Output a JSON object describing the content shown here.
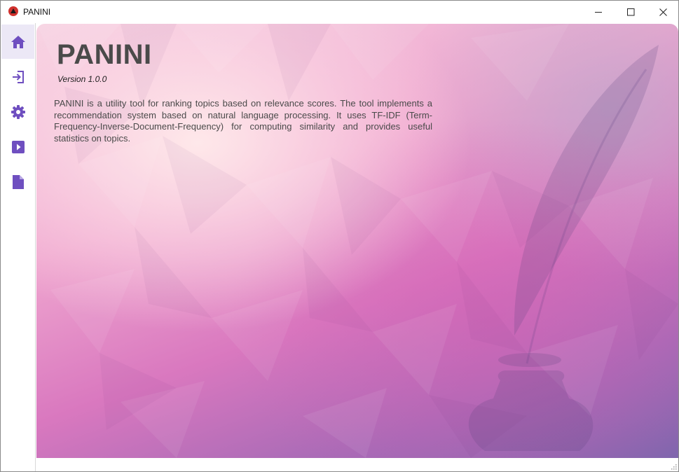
{
  "window": {
    "title": "PANINI"
  },
  "sidebar": {
    "items": [
      {
        "name": "home",
        "icon": "home-icon",
        "active": true
      },
      {
        "name": "import",
        "icon": "sign-in-icon",
        "active": false
      },
      {
        "name": "settings",
        "icon": "gear-icon",
        "active": false
      },
      {
        "name": "run",
        "icon": "play-icon",
        "active": false
      },
      {
        "name": "report",
        "icon": "document-icon",
        "active": false
      }
    ],
    "accent_color": "#6f4fc0"
  },
  "main": {
    "title": "PANINI",
    "version": "Version 1.0.0",
    "description": "PANINI is a utility tool for ranking topics based on relevance scores. The tool implements a recommendation system based on natural language processing. It uses TF-IDF (Term-Frequency-Inverse-Document-Frequency) for computing similarity and provides useful statistics on topics.",
    "background_image": "quill-and-inkwell"
  }
}
